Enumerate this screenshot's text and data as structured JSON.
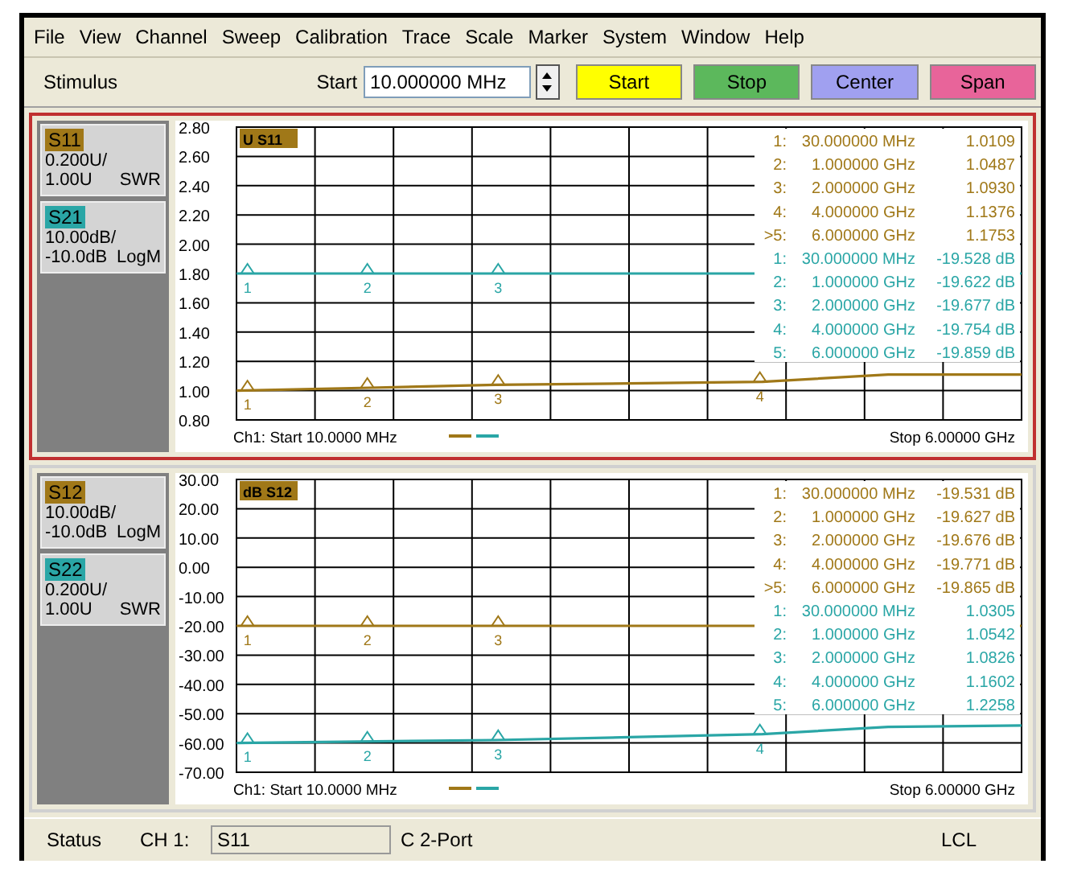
{
  "menu": [
    "File",
    "View",
    "Channel",
    "Sweep",
    "Calibration",
    "Trace",
    "Scale",
    "Marker",
    "System",
    "Window",
    "Help"
  ],
  "toolbar": {
    "label": "Stimulus",
    "field_label": "Start",
    "field_value": "10.000000 MHz",
    "buttons": [
      {
        "label": "Start",
        "color": "#ffff00"
      },
      {
        "label": "Stop",
        "color": "#5cb85c"
      },
      {
        "label": "Center",
        "color": "#a0a0f0"
      },
      {
        "label": "Span",
        "color": "#e8649a"
      }
    ]
  },
  "channels": [
    {
      "active": true,
      "plot_title": "U S11",
      "y_labels": [
        "2.80",
        "2.60",
        "2.40",
        "2.20",
        "2.00",
        "1.80",
        "1.60",
        "1.40",
        "1.20",
        "1.00",
        "0.80"
      ],
      "traces": [
        {
          "name": "S11",
          "color": "#a07818",
          "scale": "0.200U/",
          "reference": "1.00U",
          "format": "SWR",
          "marker_labels": [
            "1",
            "2",
            "3",
            "4"
          ],
          "readouts": [
            {
              "label": "1:",
              "frequency": "30.000000 MHz",
              "value": "1.0109"
            },
            {
              "label": "2:",
              "frequency": "1.000000 GHz",
              "value": "1.0487"
            },
            {
              "label": "3:",
              "frequency": "2.000000 GHz",
              "value": "1.0930"
            },
            {
              "label": "4:",
              "frequency": "4.000000 GHz",
              "value": "1.1376"
            },
            {
              "label": ">5:",
              "frequency": "6.000000 GHz",
              "value": "1.1753"
            }
          ]
        },
        {
          "name": "S21",
          "color": "#2aa6a6",
          "scale": "10.00dB/",
          "reference": "-10.0dB",
          "format": "LogM",
          "marker_labels": [
            "1",
            "2",
            "3"
          ],
          "readouts": [
            {
              "label": "1:",
              "frequency": "30.000000 MHz",
              "value": "-19.528 dB"
            },
            {
              "label": "2:",
              "frequency": "1.000000 GHz",
              "value": "-19.622 dB"
            },
            {
              "label": "3:",
              "frequency": "2.000000 GHz",
              "value": "-19.677 dB"
            },
            {
              "label": "4:",
              "frequency": "4.000000 GHz",
              "value": "-19.754 dB"
            },
            {
              "label": "5:",
              "frequency": "6.000000 GHz",
              "value": "-19.859 dB"
            }
          ]
        }
      ],
      "start": "Ch1: Start 10.0000 MHz",
      "stop": "Stop 6.00000 GHz"
    },
    {
      "active": false,
      "plot_title": "dB S12",
      "y_labels": [
        "30.00",
        "20.00",
        "10.00",
        "0.00",
        "-10.00",
        "-20.00",
        "-30.00",
        "-40.00",
        "-50.00",
        "-60.00",
        "-70.00"
      ],
      "traces": [
        {
          "name": "S12",
          "color": "#a07818",
          "scale": "10.00dB/",
          "reference": "-10.0dB",
          "format": "LogM",
          "marker_labels": [
            "1",
            "2",
            "3"
          ],
          "readouts": [
            {
              "label": "1:",
              "frequency": "30.000000 MHz",
              "value": "-19.531 dB"
            },
            {
              "label": "2:",
              "frequency": "1.000000 GHz",
              "value": "-19.627 dB"
            },
            {
              "label": "3:",
              "frequency": "2.000000 GHz",
              "value": "-19.676 dB"
            },
            {
              "label": "4:",
              "frequency": "4.000000 GHz",
              "value": "-19.771 dB"
            },
            {
              "label": ">5:",
              "frequency": "6.000000 GHz",
              "value": "-19.865 dB"
            }
          ]
        },
        {
          "name": "S22",
          "color": "#2aa6a6",
          "scale": "0.200U/",
          "reference": "1.00U",
          "format": "SWR",
          "marker_labels": [
            "1",
            "2",
            "3",
            "4"
          ],
          "readouts": [
            {
              "label": "1:",
              "frequency": "30.000000 MHz",
              "value": "1.0305"
            },
            {
              "label": "2:",
              "frequency": "1.000000 GHz",
              "value": "1.0542"
            },
            {
              "label": "3:",
              "frequency": "2.000000 GHz",
              "value": "1.0826"
            },
            {
              "label": "4:",
              "frequency": "4.000000 GHz",
              "value": "1.1602"
            },
            {
              "label": "5:",
              "frequency": "6.000000 GHz",
              "value": "1.2258"
            }
          ]
        }
      ],
      "start": "Ch1: Start 10.0000 MHz",
      "stop": "Stop 6.00000 GHz"
    }
  ],
  "status": {
    "label": "Status",
    "channel": "CH 1:",
    "field": "S11",
    "calibration": "C 2-Port",
    "mode": "LCL"
  }
}
